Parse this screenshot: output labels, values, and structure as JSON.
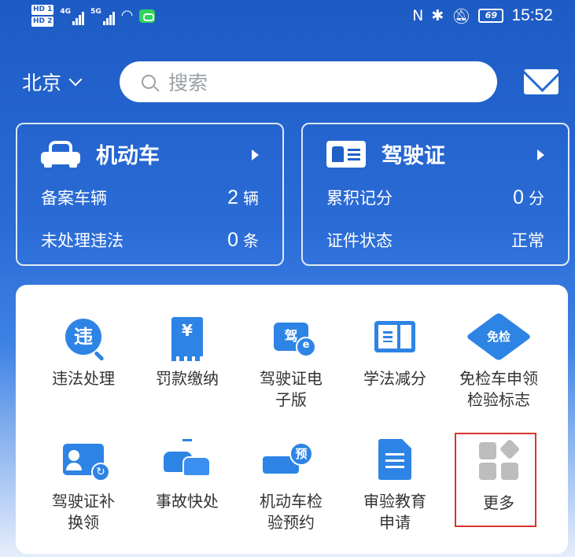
{
  "status_bar": {
    "hd1": "HD 1",
    "hd2": "HD 2",
    "net1": "4G",
    "net2": "5G",
    "battery": "69",
    "time": "15:52",
    "icons": [
      "nfc-icon",
      "bluetooth-icon",
      "mute-icon",
      "wifi-icon",
      "message-icon"
    ]
  },
  "header": {
    "city": "北京",
    "search_placeholder": "搜索"
  },
  "vehicle_card": {
    "title": "机动车",
    "rows": [
      {
        "label": "备案车辆",
        "value": "2",
        "unit": "辆"
      },
      {
        "label": "未处理违法",
        "value": "0",
        "unit": "条"
      }
    ]
  },
  "license_card": {
    "title": "驾驶证",
    "rows": [
      {
        "label": "累积记分",
        "value": "0",
        "unit": "分"
      },
      {
        "label": "证件状态",
        "value": "正常"
      }
    ]
  },
  "services": [
    {
      "label": "违法处理",
      "icon": "违"
    },
    {
      "label": "罚款缴纳",
      "icon": "¥"
    },
    {
      "label": "驾驶证电子版",
      "icon": "驾"
    },
    {
      "label": "学法减分"
    },
    {
      "label": "免检车申领检验标志",
      "icon": "免检"
    },
    {
      "label": "驾驶证补换领"
    },
    {
      "label": "事故快处"
    },
    {
      "label": "机动车检验预约",
      "icon": "预"
    },
    {
      "label": "审验教育申请"
    },
    {
      "label": "更多"
    }
  ],
  "colors": {
    "header_blue": "#1d5bc4",
    "icon_blue": "#2d84e5",
    "highlight_red": "#d9342b"
  }
}
